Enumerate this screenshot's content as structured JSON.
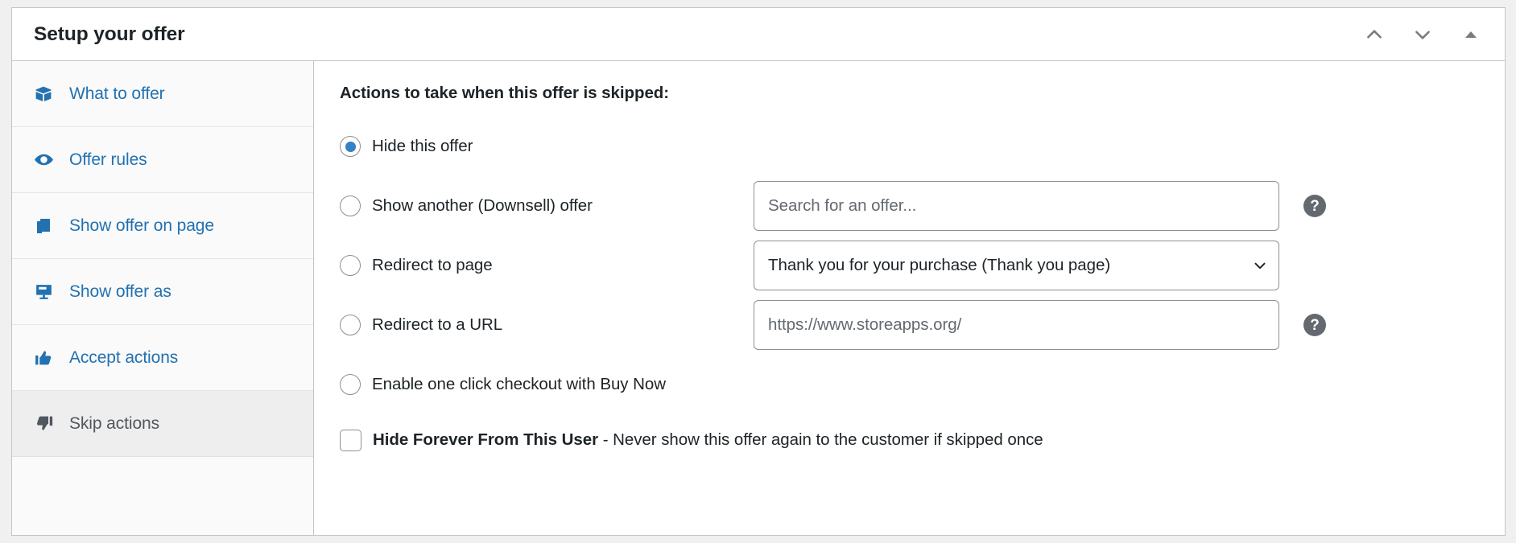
{
  "header": {
    "title": "Setup your offer",
    "actions": [
      {
        "name": "chevron-up-icon",
        "label": "Move up"
      },
      {
        "name": "chevron-down-icon",
        "label": "Move down"
      },
      {
        "name": "triangle-up-icon",
        "label": "Toggle panel"
      }
    ]
  },
  "sidebar": {
    "items": [
      {
        "label": "What to offer",
        "icon": "box-icon",
        "active": false
      },
      {
        "label": "Offer rules",
        "icon": "eye-icon",
        "active": false
      },
      {
        "label": "Show offer on page",
        "icon": "pages-icon",
        "active": false
      },
      {
        "label": "Show offer as",
        "icon": "monitor-icon",
        "active": false
      },
      {
        "label": "Accept actions",
        "icon": "thumbs-up-icon",
        "active": false
      },
      {
        "label": "Skip actions",
        "icon": "thumbs-down-icon",
        "active": true
      }
    ]
  },
  "main": {
    "heading": "Actions to take when this offer is skipped:",
    "options": [
      {
        "label": "Hide this offer",
        "selected": true
      },
      {
        "label": "Show another (Downsell) offer",
        "selected": false
      },
      {
        "label": "Redirect to page",
        "selected": false
      },
      {
        "label": "Redirect to a URL",
        "selected": false
      },
      {
        "label": "Enable one click checkout with Buy Now",
        "selected": false
      }
    ],
    "offer_search": {
      "placeholder": "Search for an offer...",
      "value": ""
    },
    "page_select": {
      "value": "Thank you for your purchase (Thank you page)"
    },
    "url_field": {
      "placeholder": "https://www.storeapps.org/",
      "value": ""
    },
    "help_icon_label": "?",
    "hide_forever": {
      "checked": false,
      "bold_text": "Hide Forever From This User",
      "rest_text": " - Never show this offer again to the customer if skipped once"
    }
  },
  "colors": {
    "accent": "#2271b1",
    "radio_fill": "#3582c4",
    "active_bg": "#eeeeee",
    "border": "#c3c4c7"
  }
}
